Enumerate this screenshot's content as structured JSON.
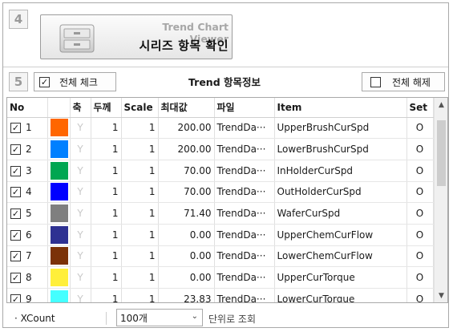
{
  "header": {
    "step_number": "4",
    "banner_title": "Trend Chart Viewer",
    "banner_subtitle": "시리즈 항목 확인"
  },
  "toolbar": {
    "step_number": "5",
    "check_all_label": "전체 체크",
    "section_title": "Trend 항목정보",
    "uncheck_all_label": "전체 해제"
  },
  "table": {
    "headers": [
      "No",
      "",
      "축",
      "두께",
      "Scale",
      "최대값",
      "파일",
      "Item",
      "Set"
    ],
    "rows": [
      {
        "no": "1",
        "checked": true,
        "color": "#ff6600",
        "axis": "Y",
        "thickness": "1",
        "scale": "1",
        "max": "200.00",
        "file": "TrendDa···",
        "item": "UpperBrushCurSpd",
        "set": "O"
      },
      {
        "no": "2",
        "checked": true,
        "color": "#0080ff",
        "axis": "Y",
        "thickness": "1",
        "scale": "1",
        "max": "200.00",
        "file": "TrendDa···",
        "item": "LowerBrushCurSpd",
        "set": "O"
      },
      {
        "no": "3",
        "checked": true,
        "color": "#00a651",
        "axis": "Y",
        "thickness": "1",
        "scale": "1",
        "max": "70.00",
        "file": "TrendDa···",
        "item": "InHolderCurSpd",
        "set": "O"
      },
      {
        "no": "4",
        "checked": true,
        "color": "#0000ff",
        "axis": "Y",
        "thickness": "1",
        "scale": "1",
        "max": "70.00",
        "file": "TrendDa···",
        "item": "OutHolderCurSpd",
        "set": "O"
      },
      {
        "no": "5",
        "checked": true,
        "color": "#7f7f7f",
        "axis": "Y",
        "thickness": "1",
        "scale": "1",
        "max": "71.40",
        "file": "TrendDa···",
        "item": "WaferCurSpd",
        "set": "O"
      },
      {
        "no": "6",
        "checked": true,
        "color": "#2e3192",
        "axis": "Y",
        "thickness": "1",
        "scale": "1",
        "max": "0.00",
        "file": "TrendDa···",
        "item": "UpperChemCurFlow",
        "set": "O"
      },
      {
        "no": "7",
        "checked": true,
        "color": "#7b3208",
        "axis": "Y",
        "thickness": "1",
        "scale": "1",
        "max": "0.00",
        "file": "TrendDa···",
        "item": "LowerChemCurFlow",
        "set": "O"
      },
      {
        "no": "8",
        "checked": true,
        "color": "#ffef3a",
        "axis": "Y",
        "thickness": "1",
        "scale": "1",
        "max": "0.00",
        "file": "TrendDa···",
        "item": "UpperCurTorque",
        "set": "O"
      },
      {
        "no": "9",
        "checked": true,
        "color": "#44ffff",
        "axis": "Y",
        "thickness": "1",
        "scale": "1",
        "max": "23.83",
        "file": "TrendDa···",
        "item": "LowerCurTorque",
        "set": "O"
      }
    ]
  },
  "footer": {
    "xcount_label": "· XCount",
    "select_value": "100개",
    "unit_text": "단위로 조회"
  }
}
